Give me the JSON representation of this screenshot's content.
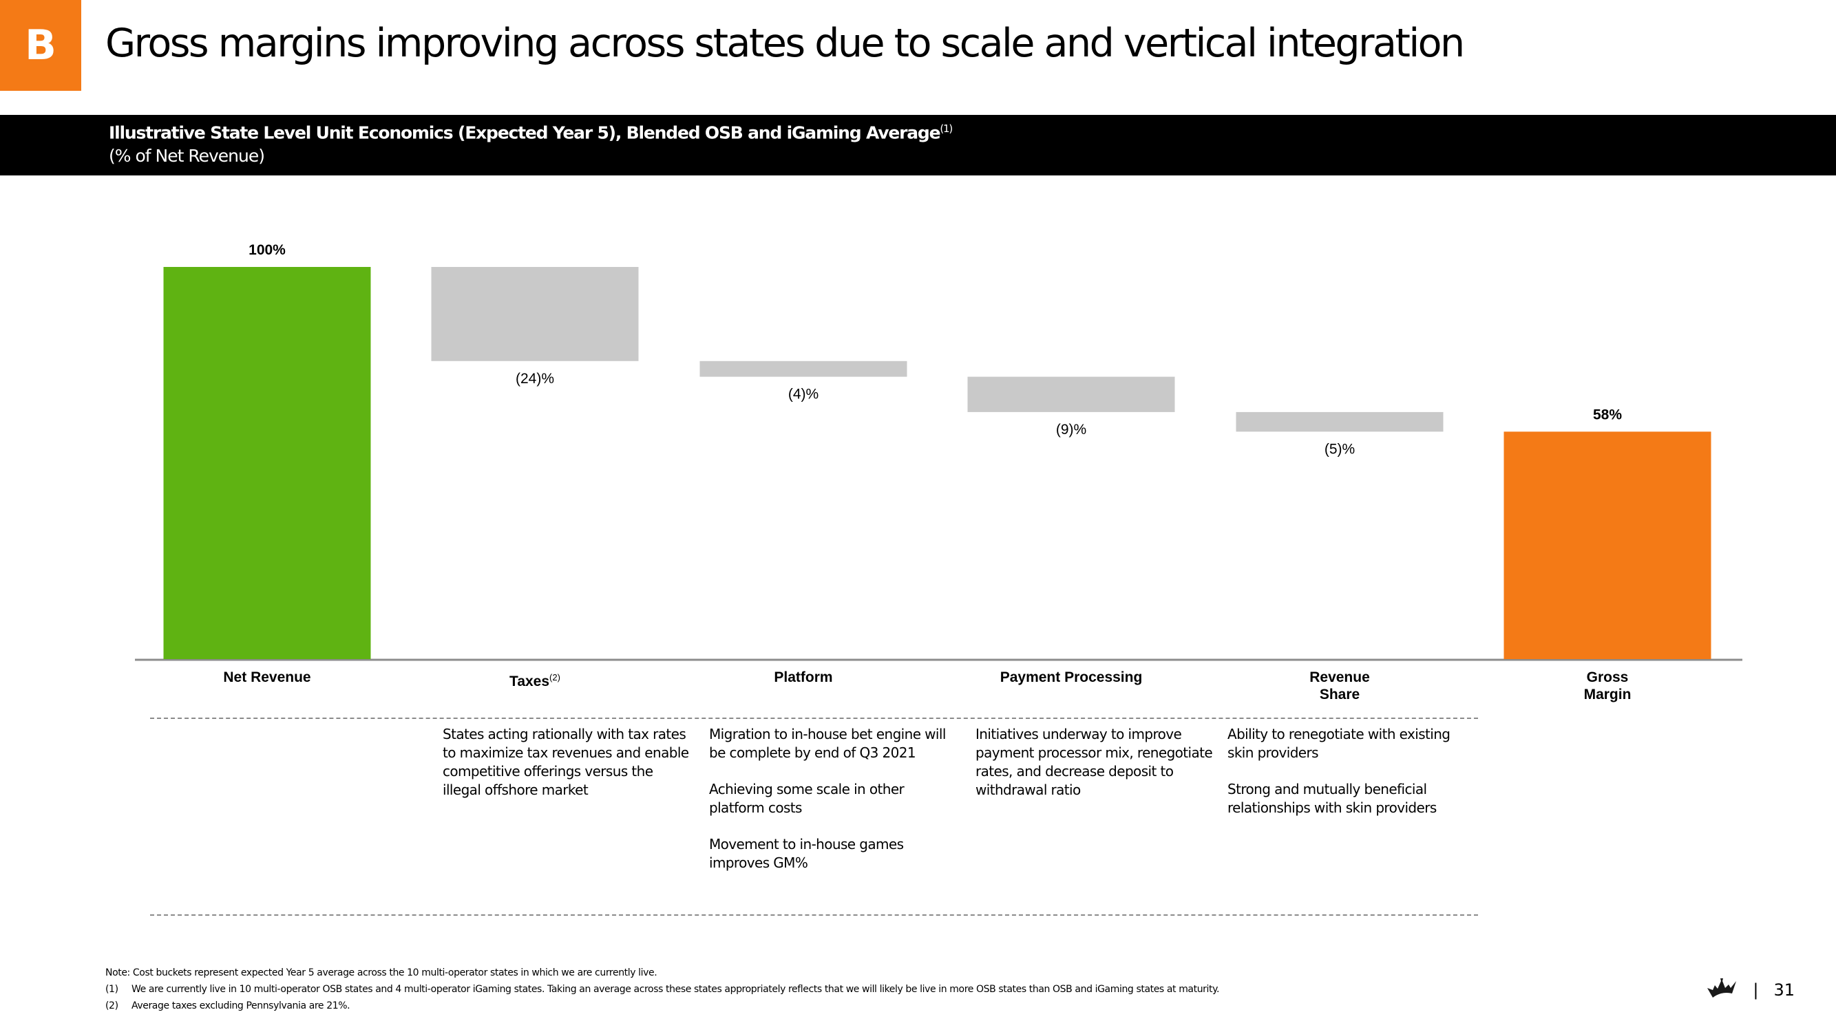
{
  "header": {
    "section_badge": "B",
    "title": "Gross margins improving across states due to scale and vertical integration"
  },
  "band": {
    "title": "Illustrative State Level Unit Economics (Expected Year 5), Blended OSB and iGaming Average",
    "title_footnote": "(1)",
    "subtitle": "(% of Net Revenue)"
  },
  "colors": {
    "accent": "#f47a16",
    "net_revenue": "#5fb312",
    "cost": "#c9c9c9",
    "gross_margin": "#f47a16",
    "axis": "#8c8c8c"
  },
  "chart_data": {
    "type": "waterfall",
    "title": "Illustrative State Level Unit Economics (Expected Year 5), Blended OSB and iGaming Average",
    "ylabel": "% of Net Revenue",
    "ylim": [
      0,
      100
    ],
    "grid": false,
    "categories": [
      "Net Revenue",
      "Taxes",
      "Platform",
      "Payment Processing",
      "Revenue Share",
      "Gross Margin"
    ],
    "category_footnotes": [
      "",
      "(2)",
      "",
      "",
      "",
      ""
    ],
    "category_lines": [
      [
        "Net Revenue"
      ],
      [
        "Taxes"
      ],
      [
        "Platform"
      ],
      [
        "Payment Processing"
      ],
      [
        "Revenue",
        "Share"
      ],
      [
        "Gross",
        "Margin"
      ]
    ],
    "values": [
      100,
      -24,
      -4,
      -9,
      -5,
      58
    ],
    "kinds": [
      "total",
      "decrease",
      "decrease",
      "decrease",
      "decrease",
      "total"
    ],
    "labels": [
      "100%",
      "(24)%",
      "(4)%",
      "(9)%",
      "(5)%",
      "58%"
    ]
  },
  "descriptions": [
    [],
    [
      "States acting rationally with tax rates to maximize tax revenues and enable competitive offerings versus the illegal offshore market"
    ],
    [
      "Migration to in-house bet engine will be complete by end of Q3 2021",
      "Achieving some scale in other platform costs",
      "Movement to in-house games improves GM%"
    ],
    [
      "Initiatives underway to improve payment processor mix, renegotiate rates, and decrease deposit to withdrawal ratio"
    ],
    [
      "Ability to renegotiate with existing skin providers",
      "Strong and mutually beneficial relationships with skin providers"
    ],
    []
  ],
  "notes": {
    "note": "Note: Cost buckets represent expected Year 5 average across the 10 multi-operator states in which we are currently live.",
    "footnotes": [
      {
        "key": "(1)",
        "text": "We are currently live in 10 multi-operator OSB states and 4 multi-operator iGaming states. Taking an average across these states appropriately reflects that we will likely be live in more OSB states than OSB and iGaming states at maturity."
      },
      {
        "key": "(2)",
        "text": "Average taxes excluding Pennsylvania are 21%."
      }
    ]
  },
  "footer": {
    "logo_icon": "crown-icon",
    "separator": "|",
    "page_number": "31"
  }
}
